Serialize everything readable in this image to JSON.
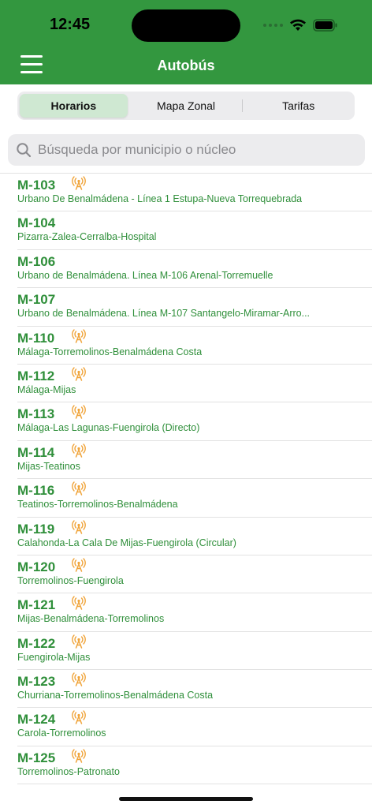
{
  "status": {
    "time": "12:45"
  },
  "header": {
    "title": "Autobús"
  },
  "tabs": [
    {
      "label": "Horarios",
      "active": true
    },
    {
      "label": "Mapa Zonal",
      "active": false
    },
    {
      "label": "Tarifas",
      "active": false
    }
  ],
  "search": {
    "placeholder": "Búsqueda por municipio o núcleo"
  },
  "colors": {
    "brand": "#33973f",
    "route_text": "#2f8f3a",
    "realtime_icon": "#f0a43a"
  },
  "routes": [
    {
      "code": "M-103",
      "name": "Urbano De Benalmádena - Línea 1 Estupa-Nueva Torrequebrada",
      "realtime": true
    },
    {
      "code": "M-104",
      "name": "Pizarra-Zalea-Cerralba-Hospital",
      "realtime": false
    },
    {
      "code": "M-106",
      "name": "Urbano de Benalmádena. Línea M-106 Arenal-Torremuelle",
      "realtime": false
    },
    {
      "code": "M-107",
      "name": "Urbano de Benalmádena. Línea M-107 Santangelo-Miramar-Arro...",
      "realtime": false
    },
    {
      "code": "M-110",
      "name": "Málaga-Torremolinos-Benalmádena Costa",
      "realtime": true
    },
    {
      "code": "M-112",
      "name": "Málaga-Mijas",
      "realtime": true
    },
    {
      "code": "M-113",
      "name": "Málaga-Las Lagunas-Fuengirola (Directo)",
      "realtime": true
    },
    {
      "code": "M-114",
      "name": "Mijas-Teatinos",
      "realtime": true
    },
    {
      "code": "M-116",
      "name": "Teatinos-Torremolinos-Benalmádena",
      "realtime": true
    },
    {
      "code": "M-119",
      "name": "Calahonda-La Cala De Mijas-Fuengirola (Circular)",
      "realtime": true
    },
    {
      "code": "M-120",
      "name": "Torremolinos-Fuengirola",
      "realtime": true
    },
    {
      "code": "M-121",
      "name": "Mijas-Benalmádena-Torremolinos",
      "realtime": true
    },
    {
      "code": "M-122",
      "name": "Fuengirola-Mijas",
      "realtime": true
    },
    {
      "code": "M-123",
      "name": "Churriana-Torremolinos-Benalmádena Costa",
      "realtime": true
    },
    {
      "code": "M-124",
      "name": "Carola-Torremolinos",
      "realtime": true
    },
    {
      "code": "M-125",
      "name": "Torremolinos-Patronato",
      "realtime": true
    }
  ]
}
